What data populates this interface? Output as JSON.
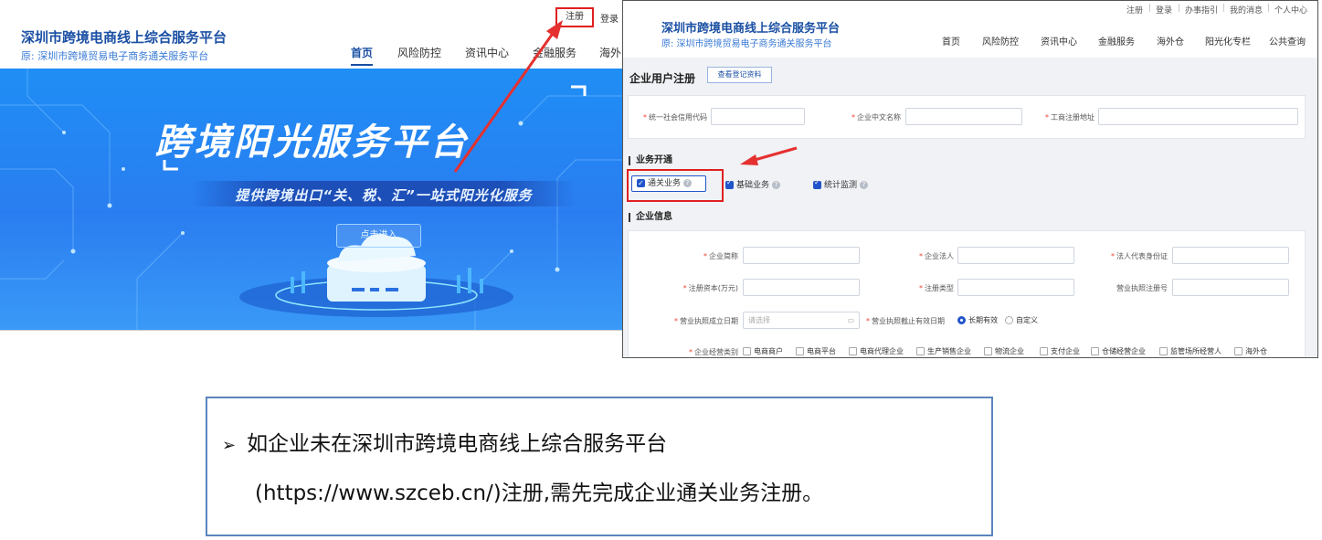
{
  "left_screen": {
    "site_title": "深圳市跨境电商线上综合服务平台",
    "site_subtitle": "原:  深圳市跨境贸易电子商务通关服务平台",
    "top_links": {
      "register": "注册",
      "login": "登录"
    },
    "nav": [
      "首页",
      "风险防控",
      "资讯中心",
      "金融服务",
      "海外"
    ],
    "active_nav": "首页",
    "banner": {
      "title": "跨境阳光服务平台",
      "subtitle": "提供跨境出口“关、税、汇”一站式阳光化服务",
      "enter_button": "点击进入"
    }
  },
  "right_screen": {
    "util_links": [
      "注册",
      "登录",
      "办事指引",
      "我的消息",
      "个人中心"
    ],
    "site_title": "深圳市跨境电商线上综合服务平台",
    "site_subtitle": "原:  深圳市跨境贸易电子商务通关服务平台",
    "nav": [
      "首页",
      "风险防控",
      "资讯中心",
      "金融服务",
      "海外仓",
      "阳光化专栏",
      "公共查询"
    ],
    "page_title": "企业用户注册",
    "view_button": "查看登记资料",
    "basic_fields": [
      "统一社会信用代码",
      "企业中文名称",
      "工商注册地址"
    ],
    "business_section": "业务开通",
    "business_options": [
      {
        "label": "通关业务",
        "checked": true
      },
      {
        "label": "基础业务",
        "checked": true
      },
      {
        "label": "统计监测",
        "checked": true
      }
    ],
    "company_section": "企业信息",
    "company_fields": {
      "row1": [
        "企业简称",
        "企业法人",
        "法人代表身份证"
      ],
      "row2": [
        "注册资本(万元)",
        "注册类型",
        "营业执照注册号"
      ],
      "license_date_label": "营业执照成立日期",
      "date_placeholder": "请选择",
      "expiry_label": "营业执照截止有效日期",
      "expiry_options": [
        "长期有效",
        "自定义"
      ],
      "expiry_selected": "长期有效",
      "category_label": "企业经营类别",
      "categories": [
        "电商商户",
        "电商平台",
        "电商代理企业",
        "生产销售企业",
        "物流企业",
        "支付企业",
        "仓储经营企业",
        "监管场所经营人",
        "海外仓"
      ]
    }
  },
  "note": {
    "line1": "如企业未在深圳市跨境电商线上综合服务平台",
    "line2": "(https://www.szceb.cn/)注册,需先完成企业通关业务注册。"
  },
  "colors": {
    "brand": "#1a4fa3",
    "highlight": "#e02020",
    "note_border": "#5b84bd"
  }
}
